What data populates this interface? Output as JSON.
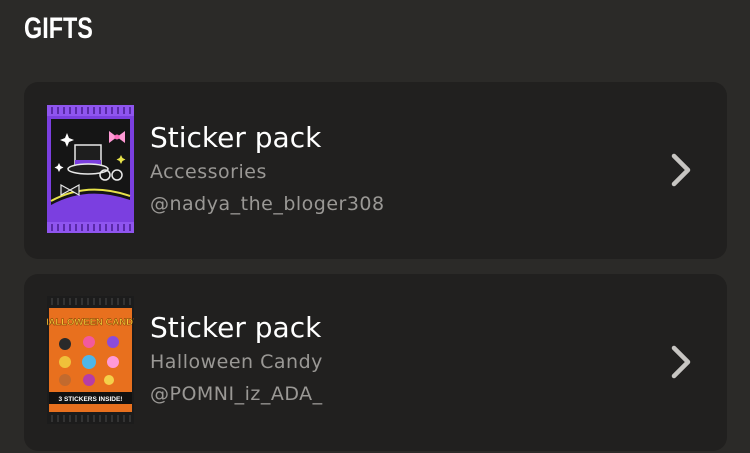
{
  "header": {
    "title": "GIFTS"
  },
  "gifts": [
    {
      "title": "Sticker pack",
      "category": "Accessories",
      "author": "@nadya_the_bloger308",
      "pack_icon": "accessories-pack-icon",
      "accent": "#7a3fd6"
    },
    {
      "title": "Sticker pack",
      "category": "Halloween Candy",
      "author": "@POMNI_iz_ADA_",
      "pack_icon": "halloween-candy-pack-icon",
      "pack_label": "HALLOWEEN CANDY",
      "pack_banner": "3 STICKERS INSIDE!",
      "accent": "#e8701e"
    }
  ],
  "colors": {
    "background": "#2b2a28",
    "card": "#21201f",
    "subtext": "#9a9895",
    "chevron": "#c7c5c2"
  }
}
